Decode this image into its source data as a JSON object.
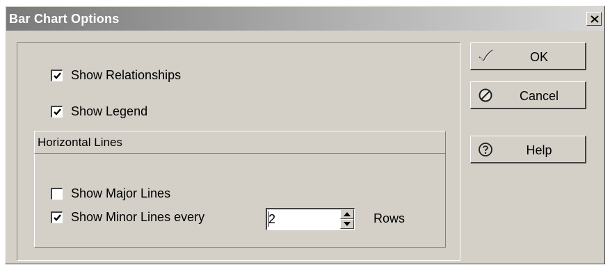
{
  "window": {
    "title": "Bar Chart Options",
    "close_glyph": "x-icon"
  },
  "options": {
    "show_relationships": {
      "label": "Show Relationships",
      "checked": true
    },
    "show_legend": {
      "label": "Show Legend",
      "checked": true
    }
  },
  "horizontal_lines": {
    "group_label": "Horizontal Lines",
    "show_major_lines": {
      "label": "Show Major Lines",
      "checked": false
    },
    "show_minor_lines": {
      "label": "Show Minor Lines every",
      "checked": true
    },
    "minor_interval_value": "2",
    "rows_label": "Rows"
  },
  "buttons": {
    "ok": {
      "label": "OK",
      "icon": "checkmark-icon"
    },
    "cancel": {
      "label": "Cancel",
      "icon": "no-entry-icon"
    },
    "help": {
      "label": "Help",
      "icon": "help-icon"
    }
  },
  "colors": {
    "dialog_face": "#d4d0c8",
    "title_gradient_start": "#7a7a7a",
    "title_text": "#ffffff"
  }
}
